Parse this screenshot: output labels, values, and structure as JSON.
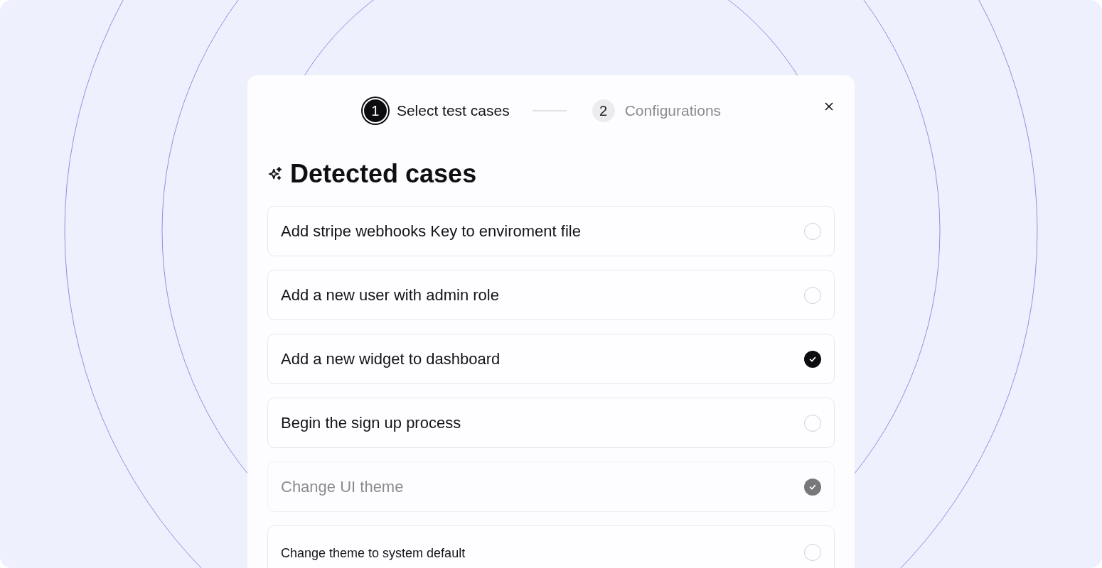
{
  "stepper": [
    {
      "number": "1",
      "label": "Select test cases",
      "selected": true
    },
    {
      "number": "2",
      "label": "Configurations",
      "selected": false
    }
  ],
  "heading": "Detected cases",
  "cases": [
    {
      "label": "Add stripe webhooks Key to enviroment file",
      "checked": false,
      "disabled": false,
      "kind": "standard"
    },
    {
      "label": "Add a new user with admin role",
      "checked": false,
      "disabled": false,
      "kind": "standard"
    },
    {
      "label": "Add a new widget to dashboard",
      "checked": true,
      "disabled": false,
      "kind": "standard"
    },
    {
      "label": "Begin the sign up process",
      "checked": false,
      "disabled": false,
      "kind": "standard"
    },
    {
      "label": "Change UI theme",
      "checked": true,
      "disabled": true,
      "kind": "standard"
    },
    {
      "label": "Change theme to system default",
      "checked": false,
      "disabled": false,
      "kind": "compact"
    }
  ]
}
